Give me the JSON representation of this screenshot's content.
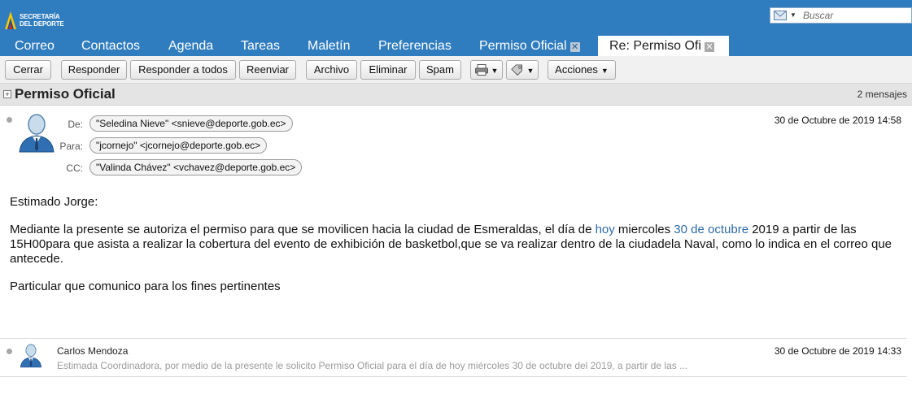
{
  "brand": {
    "line1": "SECRETARÍA",
    "line2": "DEL DEPORTE"
  },
  "search": {
    "placeholder": "Buscar"
  },
  "tabs": [
    {
      "label": "Correo",
      "closable": false,
      "active": false
    },
    {
      "label": "Contactos",
      "closable": false,
      "active": false
    },
    {
      "label": "Agenda",
      "closable": false,
      "active": false
    },
    {
      "label": "Tareas",
      "closable": false,
      "active": false
    },
    {
      "label": "Maletín",
      "closable": false,
      "active": false
    },
    {
      "label": "Preferencias",
      "closable": false,
      "active": false
    },
    {
      "label": "Permiso Oficial",
      "closable": true,
      "active": false
    },
    {
      "label": "Re: Permiso Ofi",
      "closable": true,
      "active": true
    }
  ],
  "toolbar": {
    "close": "Cerrar",
    "reply": "Responder",
    "reply_all": "Responder a todos",
    "forward": "Reenviar",
    "archive": "Archivo",
    "delete": "Eliminar",
    "spam": "Spam",
    "actions": "Acciones"
  },
  "thread": {
    "subject": "Permiso Oficial",
    "count": "2 mensajes"
  },
  "message1": {
    "from_label": "De:",
    "to_label": "Para:",
    "cc_label": "CC:",
    "from": "\"Seledina Nieve\" <snieve@deporte.gob.ec>",
    "to": "\"jcornejo\" <jcornejo@deporte.gob.ec>",
    "cc": "\"Valinda Chávez\" <vchavez@deporte.gob.ec>",
    "date": "30 de Octubre de 2019 14:58",
    "greeting": "Estimado Jorge:",
    "para_a": "Mediante la presente se autoriza el permiso para que se movilicen hacia la ciudad de Esmeraldas, el día de ",
    "link_hoy": "hoy",
    "para_b": " miercoles ",
    "link_date": "30 de octubre",
    "para_c": " 2019 a partir de las 15H00para que asista a realizar la cobertura del evento de exhibición de basketbol,que se va realizar dentro de la ciudadela Naval, como lo indica en el correo que antecede.",
    "closing": "Particular que comunico para los fines pertinentes"
  },
  "message2": {
    "sender": "Carlos Mendoza",
    "date": "30 de Octubre de 2019 14:33",
    "snippet": "Estimada Coordinadora, por medio de la presente le solicito Permiso Oficial para el día de hoy miércoles 30 de octubre del 2019, a partir de las ..."
  },
  "colors": {
    "header": "#2f7cbf",
    "link": "#2c6aa6"
  }
}
